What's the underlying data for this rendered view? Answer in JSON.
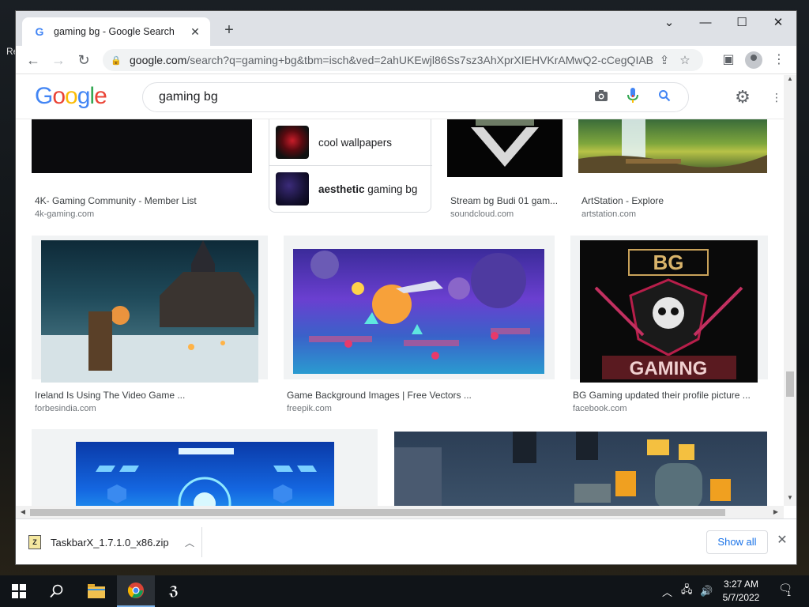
{
  "browser": {
    "tab_title": "gaming bg - Google Search",
    "tab_close": "✕",
    "new_tab": "+",
    "url_host": "google.com",
    "url_path": "/search?q=gaming+bg&tbm=isch&ved=2ahUKEwjl86Ss7sz3AhXprXIEHVKrAMwQ2-cCegQIAB...",
    "window_controls": {
      "collapse": "⌄",
      "minimize": "—",
      "maximize": "☐",
      "close": "✕"
    }
  },
  "google": {
    "logo": [
      "G",
      "o",
      "o",
      "g",
      "l",
      "e"
    ],
    "query": "gaming bg"
  },
  "results": [
    {
      "caption": "4K- Gaming Community - Member List",
      "source": "4k-gaming.com"
    },
    {
      "caption": "Stream bg Budi 01 gam...",
      "source": "soundcloud.com"
    },
    {
      "caption": "ArtStation - Explore",
      "source": "artstation.com"
    },
    {
      "caption": "Ireland Is Using The Video Game ...",
      "source": "forbesindia.com"
    },
    {
      "caption": "Game Background Images | Free Vectors ...",
      "source": "freepik.com"
    },
    {
      "caption": "BG Gaming updated their profile picture ...",
      "source": "facebook.com"
    }
  ],
  "related": [
    {
      "label": "cool wallpapers"
    },
    {
      "bold": "aesthetic",
      "rest": " gaming bg"
    }
  ],
  "images": {
    "bg_logo_top": "BG",
    "bg_logo_bottom": "GAMING"
  },
  "download": {
    "file": "TaskbarX_1.7.1.0_x86.zip",
    "show_all": "Show all",
    "zip_badge": "Z"
  },
  "taskbar": {
    "time": "3:27 AM",
    "date": "5/7/2022",
    "notifications": "1"
  },
  "desktop": {
    "peek_text": "Re"
  }
}
